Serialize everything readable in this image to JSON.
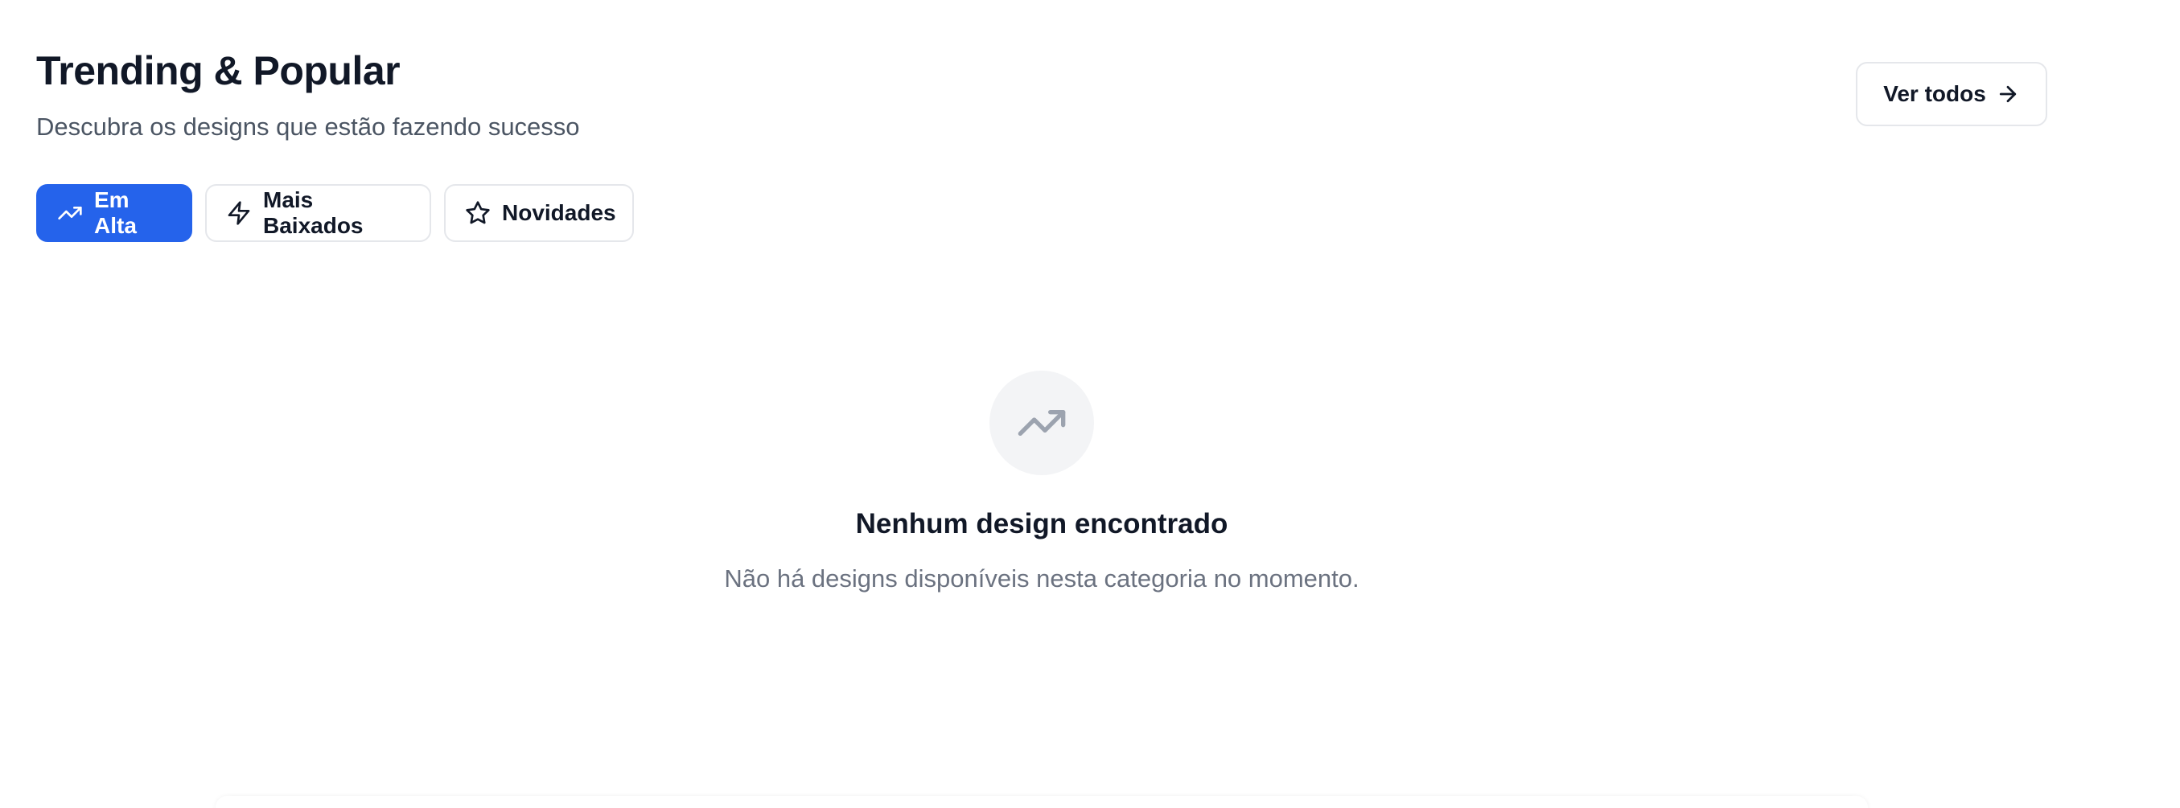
{
  "header": {
    "title": "Trending & Popular",
    "subtitle": "Descubra os designs que estão fazendo sucesso",
    "view_all_label": "Ver todos",
    "view_all_icon": "arrow-right-icon"
  },
  "tabs": [
    {
      "label": "Em Alta",
      "icon": "trending-up-icon",
      "active": true
    },
    {
      "label": "Mais Baixados",
      "icon": "lightning-icon",
      "active": false
    },
    {
      "label": "Novidades",
      "icon": "star-icon",
      "active": false
    }
  ],
  "empty_state": {
    "icon": "trending-up-icon",
    "title": "Nenhum design encontrado",
    "description": "Não há designs disponíveis nesta categoria no momento."
  },
  "colors": {
    "accent": "#2563eb",
    "text": "#111827",
    "muted": "#6b7280",
    "border": "#e5e7eb",
    "icon_bg": "#f3f4f6"
  }
}
